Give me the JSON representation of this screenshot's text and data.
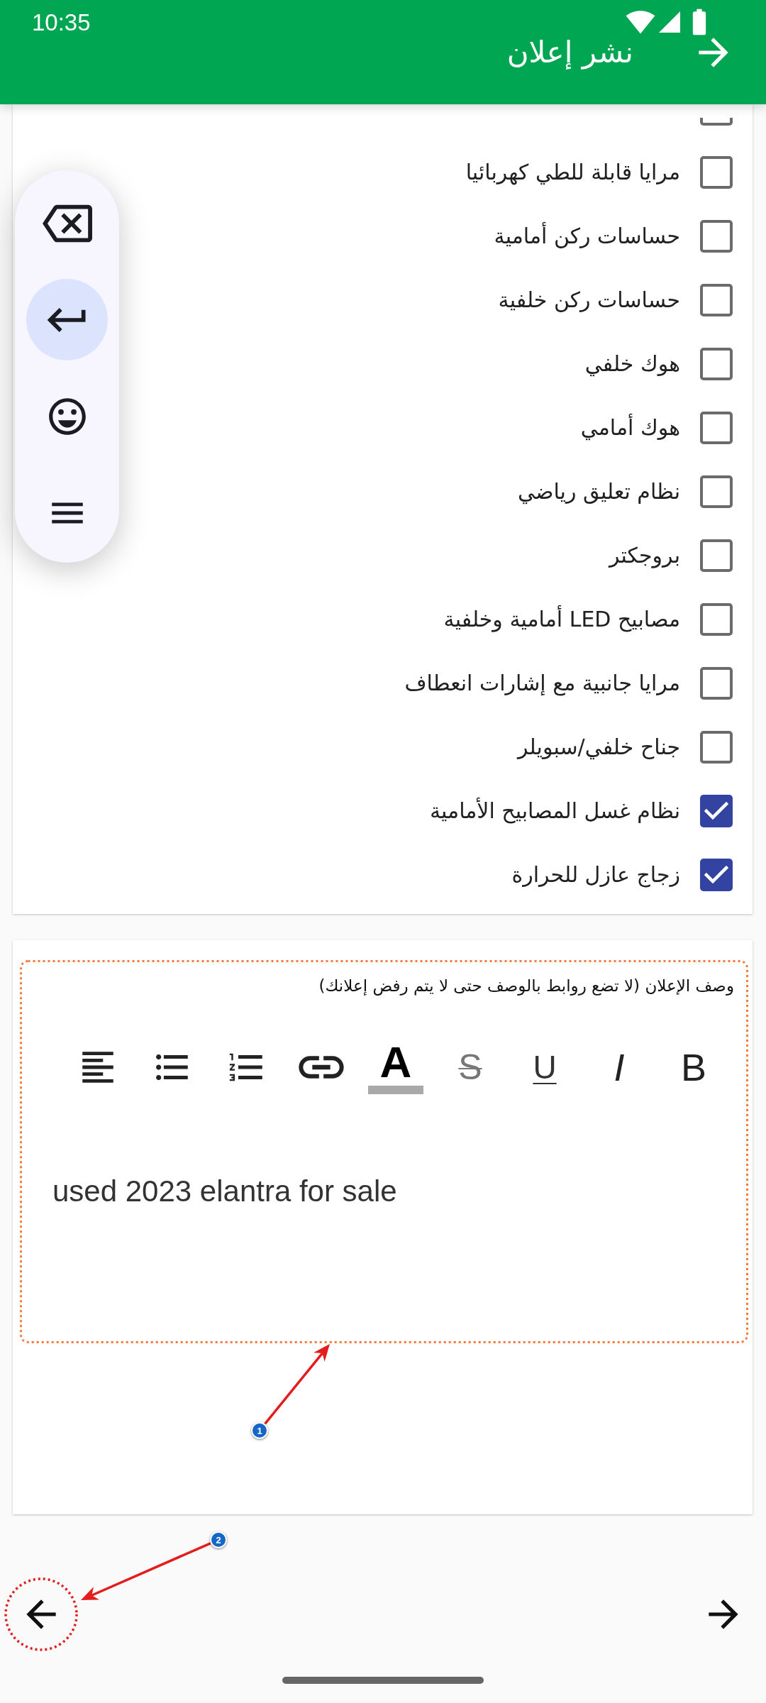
{
  "status_bar": {
    "time": "10:35"
  },
  "app_bar": {
    "title": "نشر إعلان"
  },
  "features": {
    "cut_off_item": {
      "checked": false
    },
    "items": [
      {
        "label": "مرايا قابلة للطي كهربائيا",
        "checked": false
      },
      {
        "label": "حساسات ركن أمامية",
        "checked": false
      },
      {
        "label": "حساسات ركن خلفية",
        "checked": false
      },
      {
        "label": "هوك خلفي",
        "checked": false
      },
      {
        "label": "هوك أمامي",
        "checked": false
      },
      {
        "label": "نظام تعليق رياضي",
        "checked": false
      },
      {
        "label": "بروجكتر",
        "checked": false
      },
      {
        "label": "مصابيح LED أمامية وخلفية",
        "checked": false
      },
      {
        "label": "مرايا جانبية مع إشارات انعطاف",
        "checked": false
      },
      {
        "label": "جناح خلفي/سبويلر",
        "checked": false
      },
      {
        "label": "نظام غسل المصابيح الأمامية",
        "checked": true
      },
      {
        "label": "زجاج عازل للحرارة",
        "checked": true
      }
    ]
  },
  "description": {
    "label": "وصف الإعلان (لا تضع روابط بالوصف حتى لا يتم رفض إعلانك)",
    "toolbar": [
      {
        "kind": "bold",
        "label": "B"
      },
      {
        "kind": "italic",
        "label": "I"
      },
      {
        "kind": "underline",
        "label": "U"
      },
      {
        "kind": "strikethrough",
        "label": "S"
      },
      {
        "kind": "text_color",
        "label": "A"
      },
      {
        "kind": "link"
      },
      {
        "kind": "numbered_list"
      },
      {
        "kind": "bulleted_list"
      },
      {
        "kind": "align_left"
      }
    ],
    "value": "used 2023 elantra for sale"
  },
  "keyboard_toolbar": {
    "keys": [
      {
        "kind": "backspace",
        "selected": false
      },
      {
        "kind": "enter",
        "selected": true
      },
      {
        "kind": "emoji",
        "selected": false
      },
      {
        "kind": "menu",
        "selected": false
      }
    ]
  },
  "annotations": [
    {
      "number": "1",
      "kind": "outline"
    },
    {
      "number": "2",
      "kind": "circle"
    }
  ]
}
